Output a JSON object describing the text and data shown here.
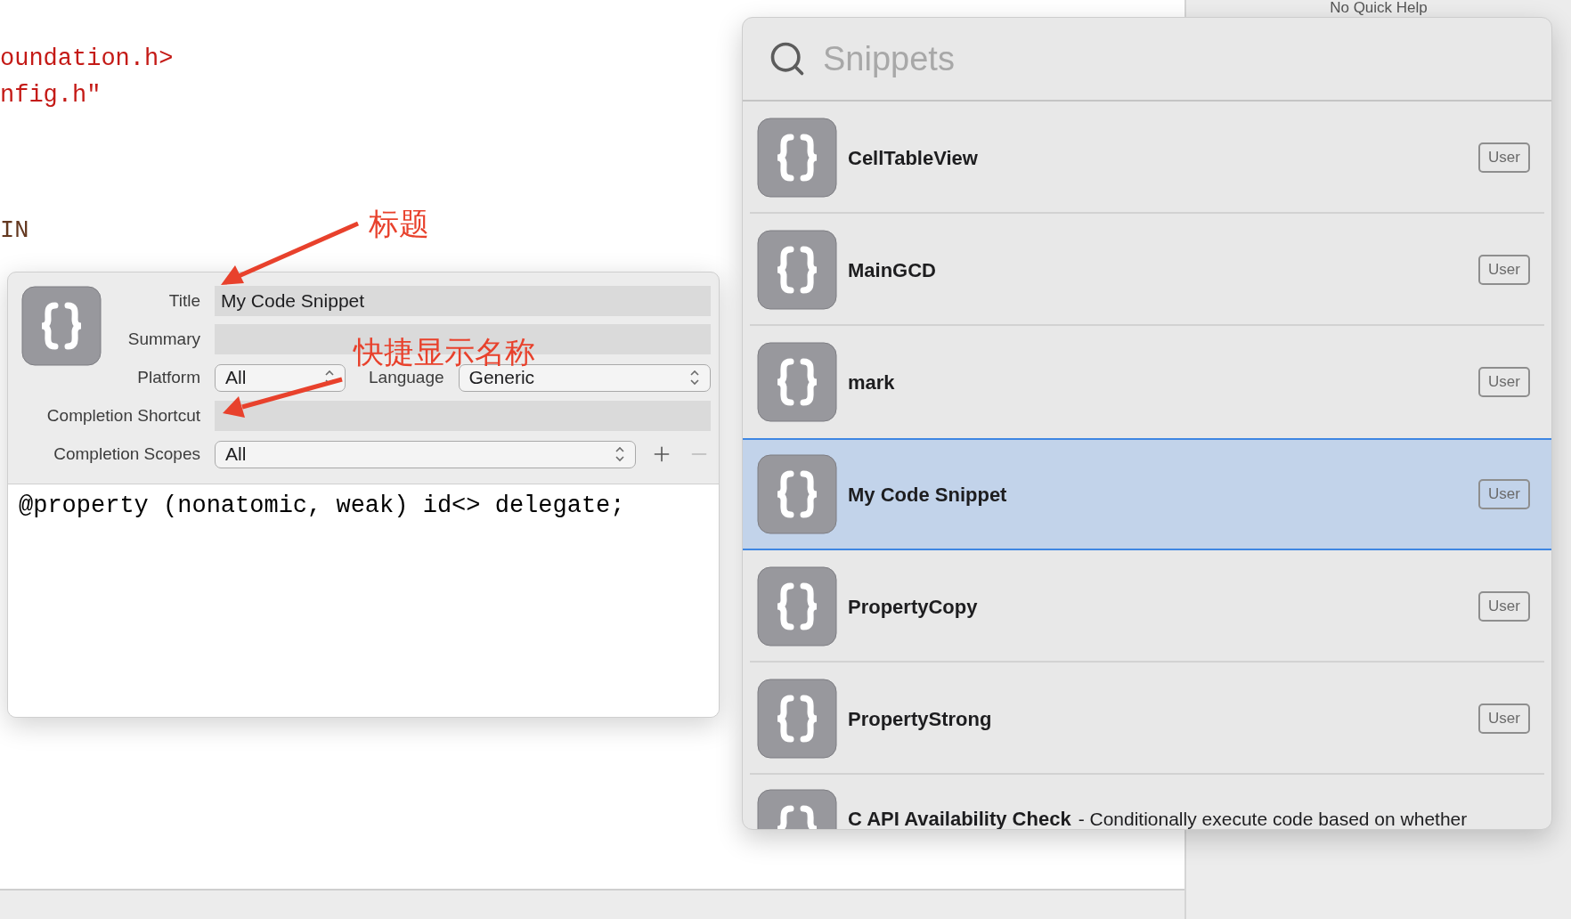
{
  "editor": {
    "code_lines": [
      {
        "text": "oundation.h>",
        "kind": "string"
      },
      {
        "text": "nfig.h\"",
        "kind": "string"
      },
      {
        "text": "IN",
        "kind": "macro"
      }
    ]
  },
  "quick_help": {
    "title": "No Quick Help"
  },
  "snippet_editor": {
    "title": {
      "label": "Title",
      "value": "My Code Snippet"
    },
    "summary": {
      "label": "Summary"
    },
    "platform": {
      "label": "Platform",
      "value": "All"
    },
    "language": {
      "label": "Language",
      "value": "Generic"
    },
    "completion_shortcut": {
      "label": "Completion Shortcut"
    },
    "completion_scopes": {
      "label": "Completion Scopes",
      "value": "All",
      "remove_disabled": true
    },
    "code": "@property (nonatomic, weak) id<> delegate;"
  },
  "annotations": [
    {
      "text": "标题"
    },
    {
      "text": "快捷显示名称"
    }
  ],
  "library": {
    "search": {
      "placeholder": "Snippets"
    },
    "items": [
      {
        "title": "CellTableView",
        "badge": "User",
        "selected": false
      },
      {
        "title": "MainGCD",
        "badge": "User",
        "selected": false
      },
      {
        "title": "mark",
        "badge": "User",
        "selected": false
      },
      {
        "title": "My Code Snippet",
        "badge": "User",
        "selected": true
      },
      {
        "title": "PropertyCopy",
        "badge": "User",
        "selected": false
      },
      {
        "title": "PropertyStrong",
        "badge": "User",
        "selected": false
      },
      {
        "title": "C API Availability Check",
        "summary": "- Conditionally execute code based on whether",
        "selected": false
      }
    ]
  }
}
